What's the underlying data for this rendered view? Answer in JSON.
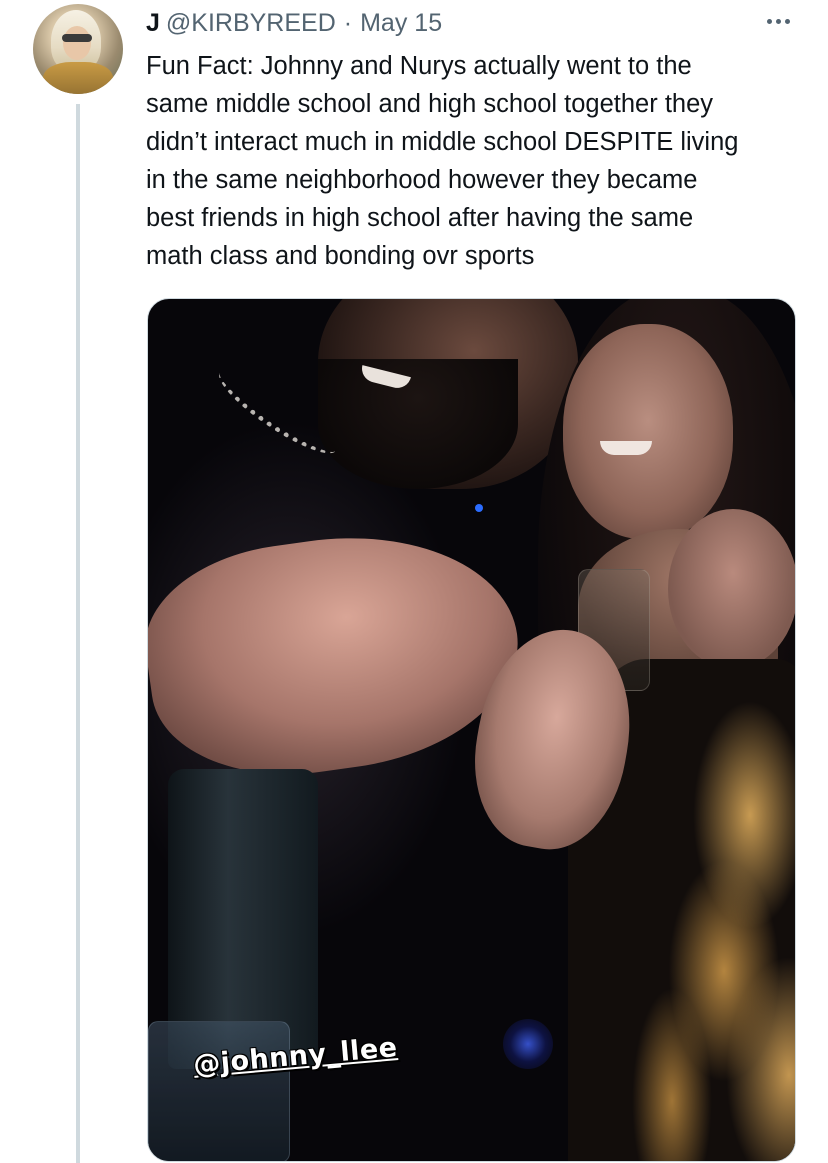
{
  "tweet": {
    "display_name": "J",
    "handle": "@KIRBYREED",
    "separator": "·",
    "date": "May 15",
    "text": "Fun Fact: Johnny and Nurys actually went to the\nsame middle school and high school together they\ndidn’t interact much in middle school DESPITE living\nin the same neighborhood however they became\nbest friends in high school after having the same\nmath class and bonding ovr sports",
    "media": {
      "sticker_text": "@johnny_llee"
    },
    "more_icon": "more-horizontal-icon"
  },
  "colors": {
    "text_primary": "#0f1419",
    "text_secondary": "#536471",
    "thread_line": "#cfd9de",
    "background": "#ffffff"
  }
}
